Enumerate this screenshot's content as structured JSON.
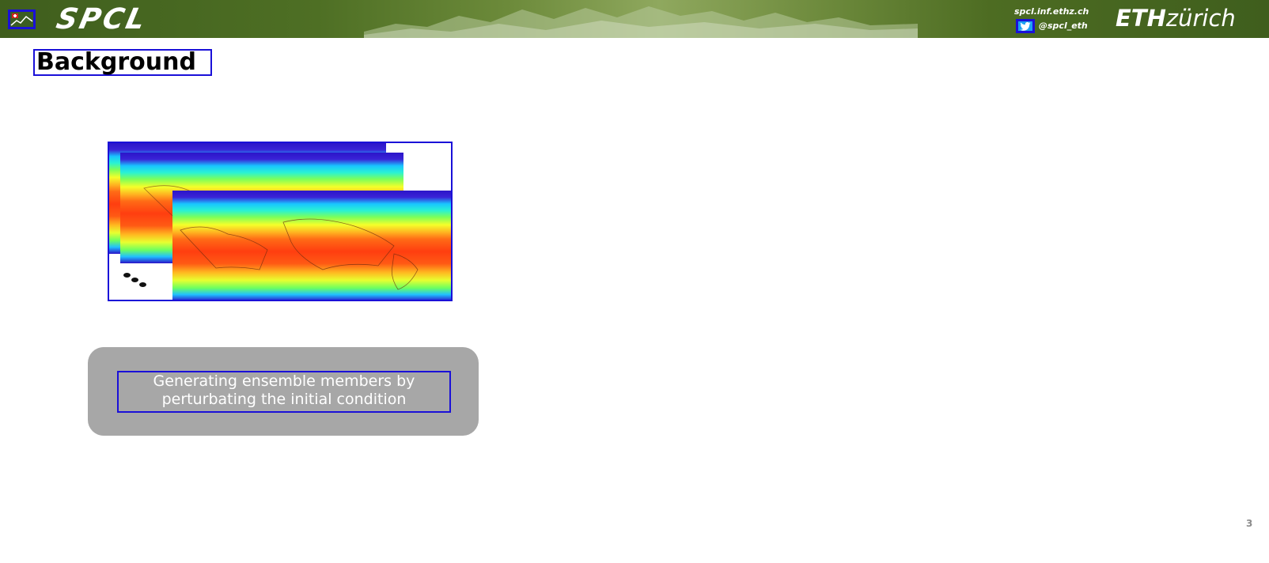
{
  "header": {
    "brand": "SPCL",
    "site_url": "spcl.inf.ethz.ch",
    "twitter_handle": "@spcl_eth",
    "eth_part": "ETH",
    "zurich_part": "zürich",
    "icons": [
      "spcl-logo-icon",
      "twitter-icon"
    ]
  },
  "slide": {
    "title": "Background",
    "caption": "Generating ensemble members by perturbating the initial condition",
    "page_number": "3"
  },
  "figure": {
    "description_icon": "stacked-global-temperature-maps"
  },
  "colors": {
    "banner_green": "#4e6f24",
    "highlight_blue": "#1a10d8",
    "caption_bg": "#a7a7a7",
    "twitter_blue": "#1da1f2"
  }
}
